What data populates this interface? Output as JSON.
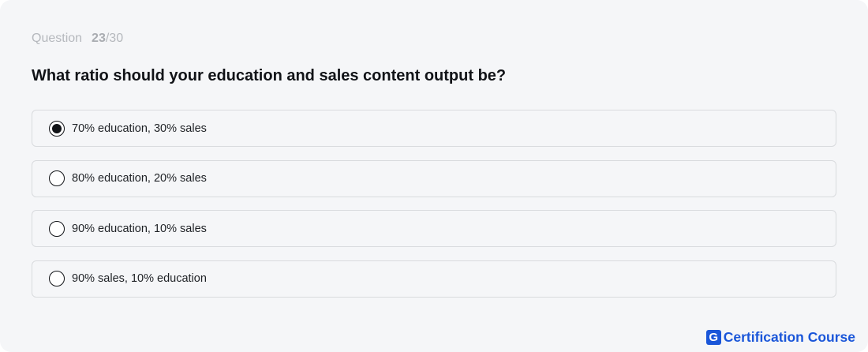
{
  "quiz": {
    "counter_label": "Question",
    "current": "23",
    "separator": "/",
    "total": "30",
    "question": "What ratio should your education and sales content output be?",
    "selected_index": 0,
    "options": [
      {
        "label": "70% education, 30% sales",
        "selected": true
      },
      {
        "label": "80% education, 20% sales",
        "selected": false
      },
      {
        "label": "90% education, 10% sales",
        "selected": false
      },
      {
        "label": "90% sales, 10% education",
        "selected": false
      }
    ]
  },
  "brand": {
    "logo_letter": "G",
    "name": "Certification Course",
    "color": "#1a56d9"
  },
  "colors": {
    "background": "#f5f6f8",
    "text": "#111317",
    "muted": "#b5b8bd",
    "border": "#d9dbde"
  }
}
